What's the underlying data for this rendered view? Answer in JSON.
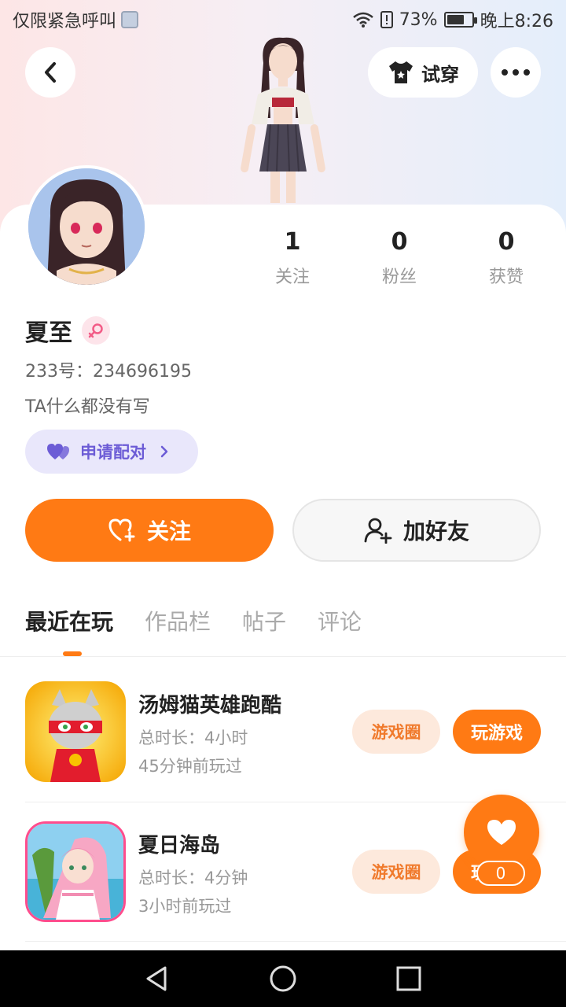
{
  "status_bar": {
    "carrier": "仅限紧急呼叫",
    "battery": "73%",
    "battery_level": 0.73,
    "time": "晚上8:26"
  },
  "header": {
    "tryon_label": "试穿"
  },
  "profile": {
    "stats": [
      {
        "value": "1",
        "label": "关注"
      },
      {
        "value": "0",
        "label": "粉丝"
      },
      {
        "value": "0",
        "label": "获赞"
      }
    ],
    "name": "夏至",
    "uid": "233号：234696195",
    "bio": "TA什么都没有写",
    "pair_label": "申请配对",
    "follow_label": "关注",
    "add_friend_label": "加好友"
  },
  "tabs": [
    {
      "label": "最近在玩",
      "active": true
    },
    {
      "label": "作品栏",
      "active": false
    },
    {
      "label": "帖子",
      "active": false
    },
    {
      "label": "评论",
      "active": false
    }
  ],
  "games": [
    {
      "title": "汤姆猫英雄跑酷",
      "duration": "总时长：4小时",
      "last_played": "45分钟前玩过",
      "circle_label": "游戏圈",
      "play_label": "玩游戏"
    },
    {
      "title": "夏日海岛",
      "duration": "总时长：4分钟",
      "last_played": "3小时前玩过",
      "circle_label": "游戏圈",
      "play_label": "玩游戏"
    }
  ],
  "like_fab": {
    "count": "0"
  },
  "colors": {
    "accent": "#ff7a14",
    "pair_bg": "#e9e7fb",
    "pair_text": "#6c5cd6"
  }
}
